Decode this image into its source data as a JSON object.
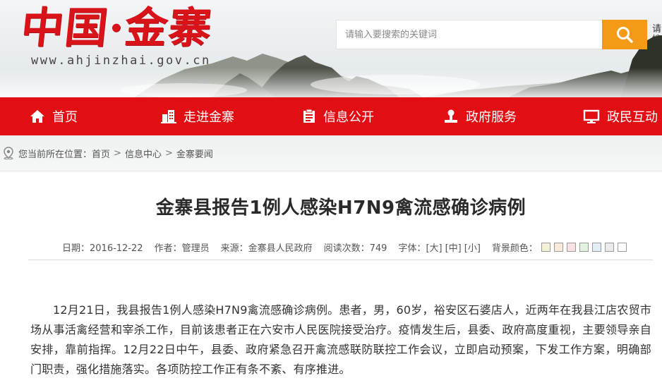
{
  "header": {
    "logo_text": "中国·金寨",
    "domain": "www.ahjinzhai.gov.cn",
    "search_placeholder": "请输入要搜索的关键词",
    "side_tab_text": "请搜"
  },
  "nav": {
    "items": [
      {
        "label": "首页",
        "icon": "home-icon"
      },
      {
        "label": "走进金寨",
        "icon": "building-icon"
      },
      {
        "label": "信息公开",
        "icon": "document-list-icon"
      },
      {
        "label": "政府服务",
        "icon": "person-service-icon"
      },
      {
        "label": "政民互动",
        "icon": "monitor-icon"
      }
    ]
  },
  "breadcrumb": {
    "prefix": "您当前所在位置：",
    "items": [
      "首页",
      "信息中心",
      "金寨要闻"
    ],
    "separator": ">"
  },
  "article": {
    "title": "金寨县报告1例人感染H7N9禽流感确诊病例",
    "meta": {
      "date": "日期：2016-12-22",
      "author": "作者：管理员",
      "source": "来源：金寨县人民政府",
      "views": "阅读次数：749",
      "font_label": "字体：",
      "font_sizes": [
        "[大]",
        "[中]",
        "[小]"
      ],
      "bg_label": "背景颜色：",
      "bg_colors": [
        "#f4f1d9",
        "#fbe9dc",
        "#fae2e2",
        "#e2f3e0",
        "#e3eef8",
        "#ebebeb",
        "#ffffff"
      ]
    },
    "paragraph": "12月21日，我县报告1例人感染H7N9禽流感确诊病例。患者，男，60岁，裕安区石婆店人，近两年在我县江店农贸市场从事活禽经营和宰杀工作，目前该患者正在六安市人民医院接受治疗。疫情发生后，县委、政府高度重视，主要领导亲自安排，靠前指挥。12月22日中午，县委、政府紧急召开禽流感联防联控工作会议，立即启动预案，下发工作方案，明确部门职责，强化措施落实。各项防控工作正有条不紊、有序推进。"
  },
  "colors": {
    "brand_red": "#e10f14",
    "search_orange": "#f39a16"
  }
}
